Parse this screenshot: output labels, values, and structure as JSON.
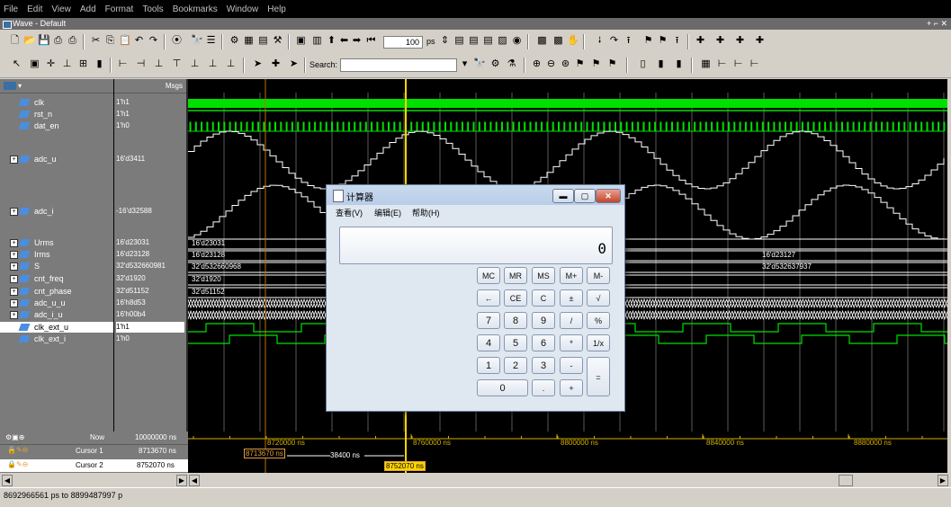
{
  "menu": [
    "File",
    "Edit",
    "View",
    "Add",
    "Format",
    "Tools",
    "Bookmarks",
    "Window",
    "Help"
  ],
  "window": {
    "title": "Wave - Default"
  },
  "toolbar": {
    "zoom_value": "100",
    "zoom_unit": "ps",
    "search_label": "Search:",
    "search_value": ""
  },
  "panes": {
    "msgs_header": "Msgs"
  },
  "signals": [
    {
      "name": "clk",
      "value": "1'h1",
      "expandable": false
    },
    {
      "name": "rst_n",
      "value": "1'h1",
      "expandable": false
    },
    {
      "name": "dat_en",
      "value": "1'h0",
      "expandable": false
    },
    {
      "name": "adc_u",
      "value": "16'd3411",
      "expandable": true
    },
    {
      "name": "adc_i",
      "value": "-16'd32588",
      "expandable": true
    },
    {
      "name": "Urms",
      "value": "16'd23031",
      "expandable": true
    },
    {
      "name": "Irms",
      "value": "16'd23128",
      "expandable": true
    },
    {
      "name": "S",
      "value": "32'd532660981",
      "expandable": true
    },
    {
      "name": "cnt_freq",
      "value": "32'd1920",
      "expandable": true
    },
    {
      "name": "cnt_phase",
      "value": "32'd51152",
      "expandable": true
    },
    {
      "name": "adc_u_u",
      "value": "16'h8d53",
      "expandable": true
    },
    {
      "name": "adc_i_u",
      "value": "16'h00b4",
      "expandable": true
    },
    {
      "name": "clk_ext_u",
      "value": "1'h1",
      "expandable": false
    },
    {
      "name": "clk_ext_i",
      "value": "1'h0",
      "expandable": false
    }
  ],
  "bus_labels": {
    "Urms": "16'd23031",
    "Irms": "16'd23128",
    "Irms_right": "16'd23127",
    "S": "32'd532660968",
    "S_right": "32'd532637937",
    "cnt_freq": "32'd1920",
    "cnt_phase": "32'd51152"
  },
  "cursors": {
    "now_label": "Now",
    "now_value": "10000000 ns",
    "cursor1_label": "Cursor 1",
    "cursor1_value": "8713670 ns",
    "cursor2_label": "Cursor 2",
    "cursor2_value": "8752070 ns",
    "cursor1_tag": "8713670 ns",
    "cursor2_tag": "8752070 ns",
    "delta_tag": "38400 ns"
  },
  "time_axis": [
    "8720000 ns",
    "8760000 ns",
    "8800000 ns",
    "8840000 ns",
    "8880000 ns"
  ],
  "status": {
    "range": "8692966561 ps to 8899487997 p"
  },
  "calculator": {
    "title": "计算器",
    "menu": [
      "查看(V)",
      "编辑(E)",
      "帮助(H)"
    ],
    "display": "0",
    "buttons": [
      [
        "MC",
        "MR",
        "MS",
        "M+",
        "M-"
      ],
      [
        "←",
        "CE",
        "C",
        "±",
        "√"
      ],
      [
        "7",
        "8",
        "9",
        "/",
        "%"
      ],
      [
        "4",
        "5",
        "6",
        "*",
        "1/x"
      ],
      [
        "1",
        "2",
        "3",
        "-",
        ""
      ],
      [
        "0",
        "",
        ".",
        "+",
        ""
      ]
    ]
  },
  "colors": {
    "wave_green": "#00e000",
    "cursor1": "#c07000",
    "cursor2": "#ffd400",
    "grid": "#5a5a5a"
  }
}
